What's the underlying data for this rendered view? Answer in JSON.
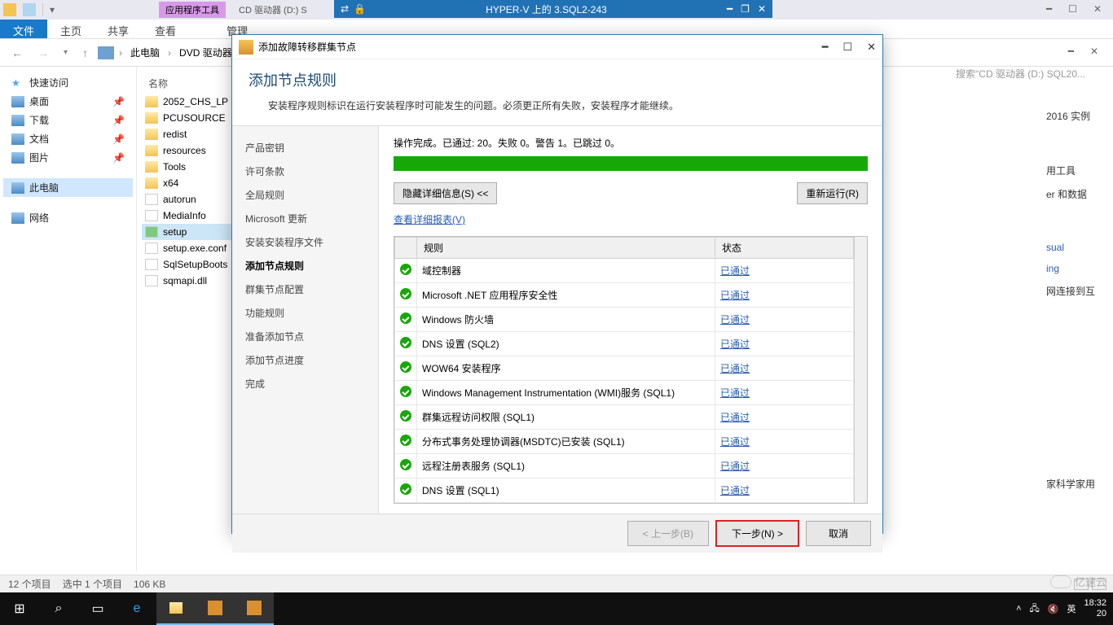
{
  "topstrip": {
    "app_tool": "应用程序工具",
    "cd_tab": "CD 驱动器 (D:) S"
  },
  "hyperv": {
    "title": "HYPER-V 上的 3.SQL2-243"
  },
  "ribbon": {
    "file": "文件",
    "home": "主页",
    "share": "共享",
    "view": "查看",
    "manage": "管理"
  },
  "breadcrumb": {
    "pc": "此电脑",
    "drive": "DVD 驱动器 ("
  },
  "search_hint": "搜索\"CD 驱动器 (D:) SQL20...",
  "tree": {
    "quick": "快速访问",
    "desktop": "桌面",
    "downloads": "下载",
    "documents": "文档",
    "pictures": "图片",
    "thispc": "此电脑",
    "network": "网络"
  },
  "files": {
    "header": "名称",
    "items": [
      "2052_CHS_LP",
      "PCUSOURCE",
      "redist",
      "resources",
      "Tools",
      "x64",
      "autorun",
      "MediaInfo",
      "setup",
      "setup.exe.conf",
      "SqlSetupBoots",
      "sqmapi.dll"
    ]
  },
  "right": {
    "l1": "2016 实例",
    "l2": "用工具",
    "l3": "er 和数据",
    "l4": "sual",
    "l5": "ing",
    "l6": "网连接到互",
    "l7": "家科学家用"
  },
  "wizard": {
    "window_title": "添加故障转移群集节点",
    "header_title": "添加节点规则",
    "header_desc": "安装程序规则标识在运行安装程序时可能发生的问题。必须更正所有失败，安装程序才能继续。",
    "steps": [
      "产品密钥",
      "许可条款",
      "全局规则",
      "Microsoft 更新",
      "安装安装程序文件",
      "添加节点规则",
      "群集节点配置",
      "功能规则",
      "准备添加节点",
      "添加节点进度",
      "完成"
    ],
    "active_step_index": 5,
    "status_line": "操作完成。已通过: 20。失败 0。警告 1。已跳过 0。",
    "hide_btn": "隐藏详细信息(S) <<",
    "rerun_btn": "重新运行(R)",
    "report_link": "查看详细报表(V)",
    "col_rule": "规则",
    "col_status": "状态",
    "passed": "已通过",
    "rules": [
      "域控制器",
      "Microsoft .NET 应用程序安全性",
      "Windows 防火墙",
      "DNS 设置 (SQL2)",
      "WOW64 安装程序",
      "Windows Management Instrumentation (WMI)服务 (SQL1)",
      "群集远程访问权限 (SQL1)",
      "分布式事务处理协调器(MSDTC)已安装 (SQL1)",
      "远程注册表服务 (SQL1)",
      "DNS 设置 (SQL1)"
    ],
    "back": "< 上一步(B)",
    "next": "下一步(N) >",
    "cancel": "取消"
  },
  "statusbar": {
    "count": "12 个项目",
    "selected": "选中 1 个项目",
    "size": "106 KB"
  },
  "tray": {
    "ime": "英",
    "time": "18:32",
    "date": "20"
  },
  "watermark": "亿速云"
}
